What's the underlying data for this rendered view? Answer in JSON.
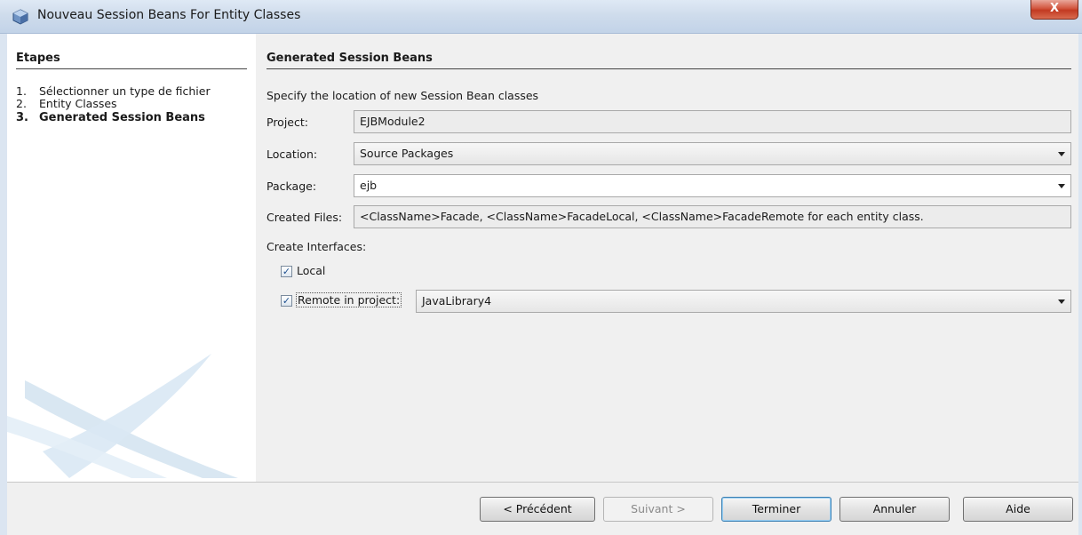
{
  "window": {
    "title": "Nouveau Session Beans For Entity Classes",
    "close_label": "X"
  },
  "steps": {
    "title": "Etapes",
    "items": [
      {
        "num": "1.",
        "label": "Sélectionner un type de fichier"
      },
      {
        "num": "2.",
        "label": "Entity Classes"
      },
      {
        "num": "3.",
        "label": "Generated Session Beans"
      }
    ]
  },
  "main": {
    "section_title": "Generated Session Beans",
    "description": "Specify the location of new Session Bean classes",
    "project_label": "Project:",
    "project_value": "EJBModule2",
    "location_label": "Location:",
    "location_value": "Source Packages",
    "package_label": "Package:",
    "package_value": "ejb",
    "created_files_label": "Created Files:",
    "created_files_value": "<ClassName>Facade, <ClassName>FacadeLocal, <ClassName>FacadeRemote for each entity class.",
    "create_interfaces_label": "Create Interfaces:",
    "local_label": "Local",
    "local_checked": true,
    "remote_label": "Remote in project:",
    "remote_checked": true,
    "remote_project_value": "JavaLibrary4",
    "check_glyph": "✓"
  },
  "buttons": {
    "previous": "< Précédent",
    "next": "Suivant >",
    "finish": "Terminer",
    "cancel": "Annuler",
    "help": "Aide"
  }
}
